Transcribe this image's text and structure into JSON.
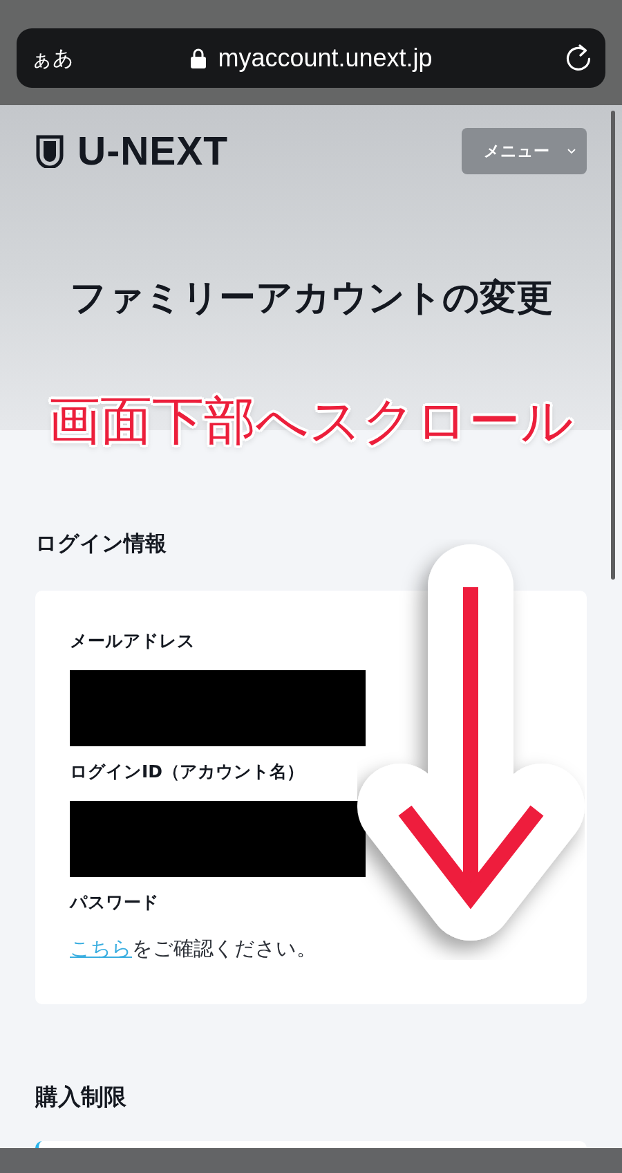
{
  "browser": {
    "text_size_button": "ぁあ",
    "url": "myaccount.unext.jp"
  },
  "header": {
    "logo": "U-NEXT",
    "menu_button": "メニュー",
    "title": "ファミリーアカウントの変更"
  },
  "annotation": {
    "text": "画面下部へスクロール"
  },
  "login_section": {
    "heading": "ログイン情報",
    "fields": [
      {
        "label": "メールアドレス",
        "kind": "redacted"
      },
      {
        "label": "ログインID（アカウント名）",
        "kind": "redacted"
      },
      {
        "label": "パスワード",
        "kind": "link_note",
        "link": "こちら",
        "text": "をご確認ください。"
      }
    ]
  },
  "purchase_section": {
    "heading": "購入制限"
  }
}
